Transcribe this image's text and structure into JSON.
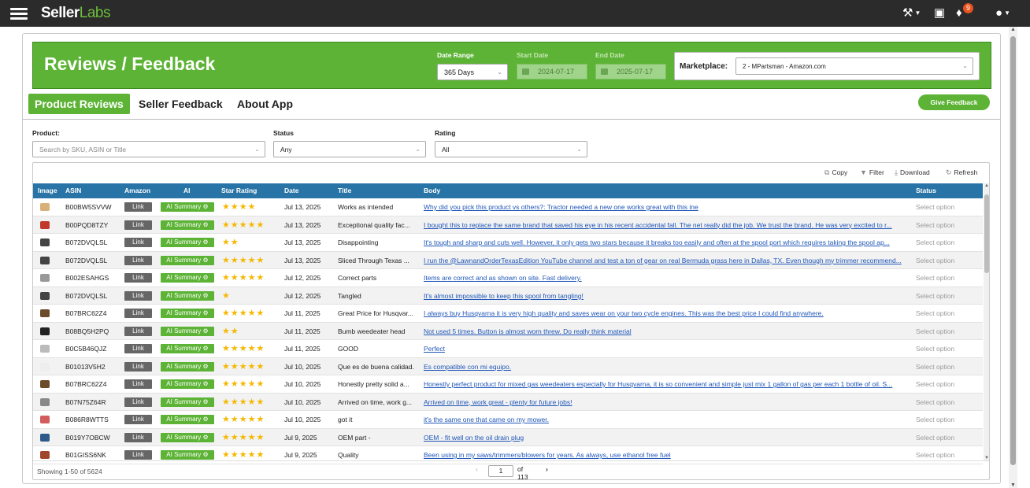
{
  "topbar": {
    "logo_seller": "Seller",
    "logo_labs": "Labs",
    "notifications_count": "9"
  },
  "header": {
    "title": "Reviews / Feedback",
    "date_range_label": "Date Range",
    "date_range_value": "365 Days",
    "start_date_label": "Start Date",
    "start_date_value": "2024-07-17",
    "end_date_label": "End Date",
    "end_date_value": "2025-07-17",
    "marketplace_label": "Marketplace:",
    "marketplace_value": "2 - MPartsman - Amazon.com"
  },
  "tabs": [
    {
      "label": "Product Reviews",
      "active": true
    },
    {
      "label": "Seller Feedback",
      "active": false
    },
    {
      "label": "About App",
      "active": false
    }
  ],
  "give_feedback_label": "Give Feedback",
  "filters": {
    "product_label": "Product:",
    "product_placeholder": "Search by SKU, ASIN or Title",
    "status_label": "Status",
    "status_value": "Any",
    "rating_label": "Rating",
    "rating_value": "All"
  },
  "toolbar": {
    "copy": "Copy",
    "filter": "Filter",
    "download": "Download",
    "refresh": "Refresh"
  },
  "table": {
    "columns": [
      "Image",
      "ASIN",
      "Amazon",
      "AI",
      "Star Rating",
      "Date",
      "Title",
      "Body",
      "Status"
    ],
    "link_label": "Link",
    "ai_label": "AI Summary",
    "status_placeholder": "Select option",
    "rows": [
      {
        "asin": "B00BW5SVVW",
        "stars": 4,
        "date": "Jul 13, 2025",
        "title": "Works as intended",
        "body": "Why did you pick this product vs others?: Tractor needed a new one works great with this ine",
        "thumb": "#d8b07a"
      },
      {
        "asin": "B00PQD8TZY",
        "stars": 5,
        "date": "Jul 13, 2025",
        "title": "Exceptional quality fac...",
        "body": "I bought this to replace the same brand that saved his eye in his recent accidental fall. The net really did the job. We trust the brand. He was very excited to r...",
        "thumb": "#c0392b"
      },
      {
        "asin": "B072DVQLSL",
        "stars": 2,
        "date": "Jul 13, 2025",
        "title": "Disappointing",
        "body": "It's tough and sharp and cuts well. However, it only gets two stars because it breaks too easily and often at the spool port which requires taking the spool ap...",
        "thumb": "#444444"
      },
      {
        "asin": "B072DVQLSL",
        "stars": 5,
        "date": "Jul 13, 2025",
        "title": "Sliced Through Texas ...",
        "body": "I run the @LawnandOrderTexasEdition YouTube channel and test a ton of gear on real Bermuda grass here in Dallas, TX. Even though my trimmer recommend...",
        "thumb": "#444444"
      },
      {
        "asin": "B002ESAHGS",
        "stars": 5,
        "date": "Jul 12, 2025",
        "title": "Correct parts",
        "body": "Items are correct and as shown on site. Fast delivery.",
        "thumb": "#999999"
      },
      {
        "asin": "B072DVQLSL",
        "stars": 1,
        "date": "Jul 12, 2025",
        "title": "Tangled",
        "body": "It's almost impossible to keep this spool from tangling!",
        "thumb": "#444444"
      },
      {
        "asin": "B07BRC62Z4",
        "stars": 5,
        "date": "Jul 11, 2025",
        "title": "Great Price for Husqvar...",
        "body": "I always buy Husqvarna it is very high quality and saves wear on your two cycle engines. This was the best price I could find anywhere.",
        "thumb": "#6b4a2a"
      },
      {
        "asin": "B08BQ5H2PQ",
        "stars": 2,
        "date": "Jul 11, 2025",
        "title": "Bumb weedeater head",
        "body": "Not used 5 times. Button is almost worn threw. Do really think material",
        "thumb": "#222222"
      },
      {
        "asin": "B0C5B46QJZ",
        "stars": 5,
        "date": "Jul 11, 2025",
        "title": "GOOD",
        "body": "Perfect",
        "thumb": "#bbbbbb"
      },
      {
        "asin": "B01013V5H2",
        "stars": 5,
        "date": "Jul 10, 2025",
        "title": "Que es de buena calidad.",
        "body": "Es compatible con mi equipo.",
        "thumb": "#eeeeee"
      },
      {
        "asin": "B07BRC62Z4",
        "stars": 5,
        "date": "Jul 10, 2025",
        "title": "Honestly pretty solid a...",
        "body": "Honestly perfect product for mixed gas weedeaters especially for Husqvarna, it is so convenient and simple just mix 1 gallon of gas per each 1 bottle of oil. S...",
        "thumb": "#6b4a2a"
      },
      {
        "asin": "B07N75Z64R",
        "stars": 5,
        "date": "Jul 10, 2025",
        "title": "Arrived on time, work g...",
        "body": "Arrived on time, work great - plenty for future jobs!",
        "thumb": "#888888"
      },
      {
        "asin": "B086R8WTTS",
        "stars": 5,
        "date": "Jul 10, 2025",
        "title": "got it",
        "body": "it's the same one that came on my mower.",
        "thumb": "#d35b5b"
      },
      {
        "asin": "B019Y7OBCW",
        "stars": 5,
        "date": "Jul 9, 2025",
        "title": "OEM part -",
        "body": "OEM - fit well on the oil drain plug",
        "thumb": "#2e5a8a"
      },
      {
        "asin": "B01GISS6NK",
        "stars": 5,
        "date": "Jul 9, 2025",
        "title": "Quality",
        "body": "Been using in my saws/trimmers/blowers for years. As always, use ethanol free fuel",
        "thumb": "#a0462c"
      }
    ]
  },
  "footer": {
    "showing": "Showing 1-50 of 5624",
    "page": "1",
    "of_pages": "of 113"
  }
}
